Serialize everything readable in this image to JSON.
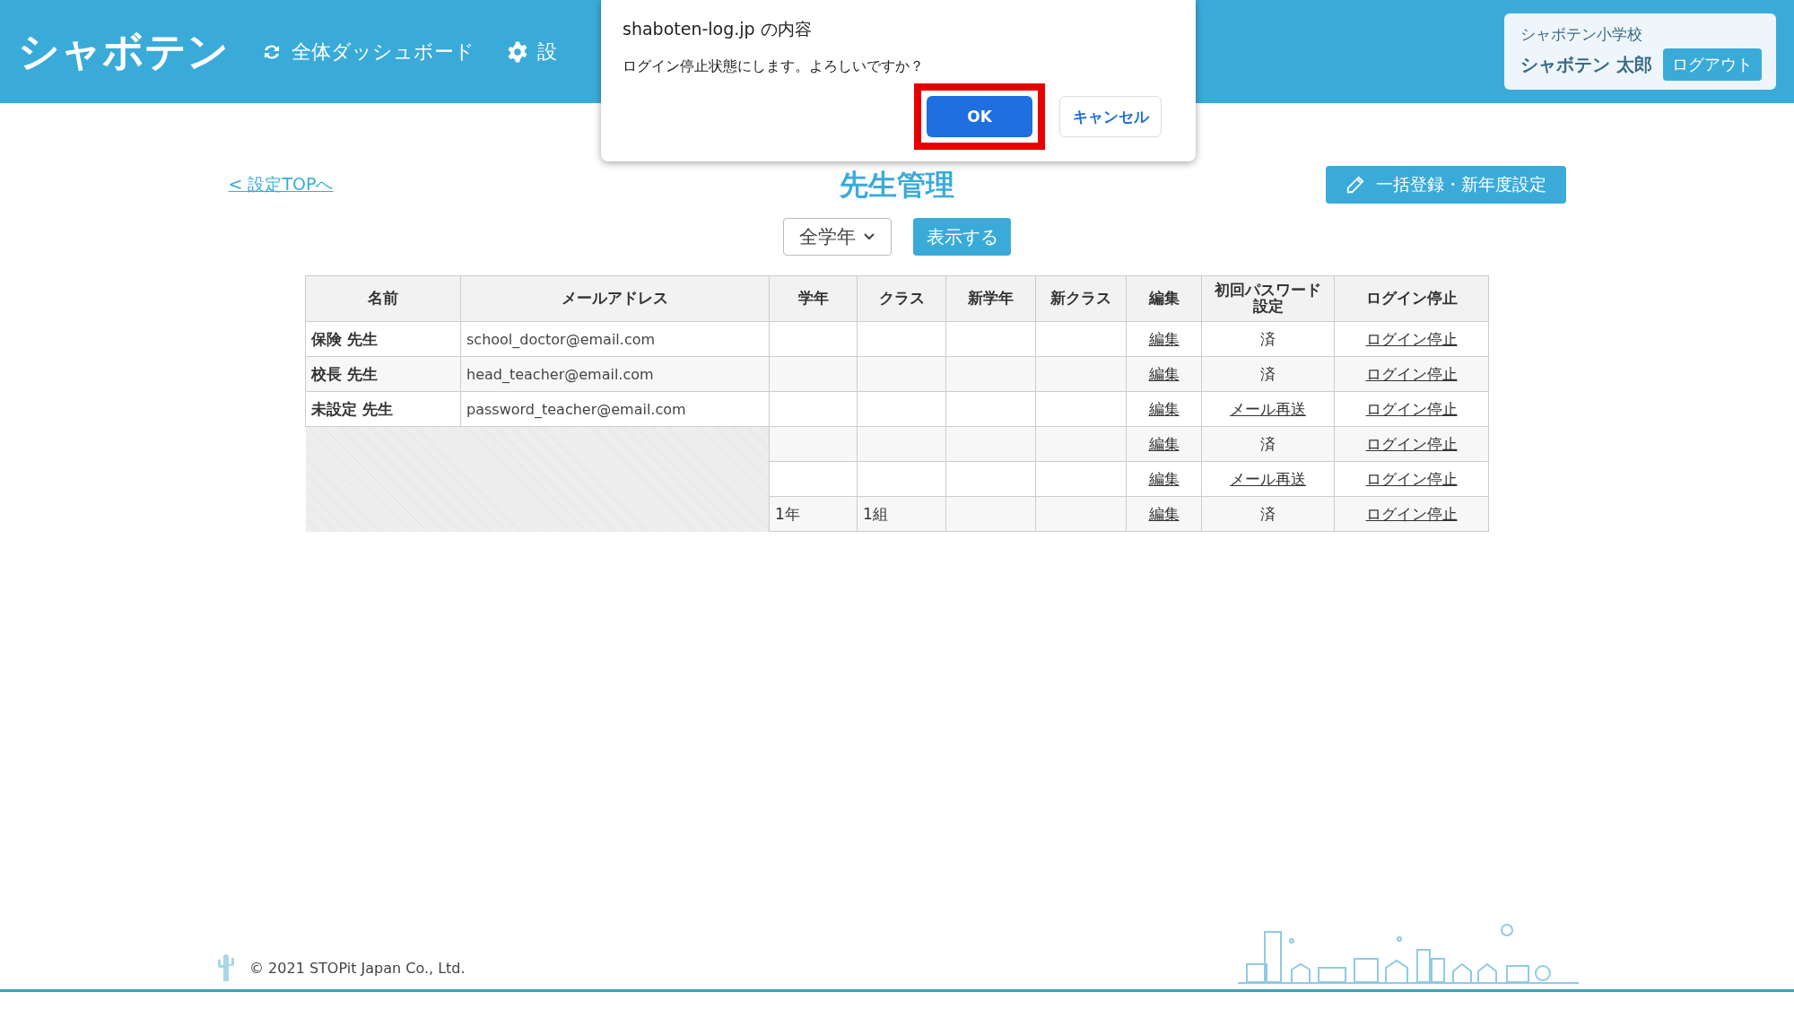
{
  "header": {
    "logo": "シャボテン",
    "nav": [
      {
        "kind": "sync",
        "label": "全体ダッシュボード"
      },
      {
        "kind": "settings",
        "label": "設"
      }
    ],
    "user": {
      "school": "シャボテン小学校",
      "name": "シャボテン 太郎",
      "logout": "ログアウト"
    }
  },
  "dialog": {
    "title": "shaboten-log.jp の内容",
    "message": "ログイン停止状態にします。よろしいですか？",
    "buttons": [
      {
        "label": "OK",
        "kind": "primary",
        "highlighted": true
      },
      {
        "label": "キャンセル",
        "kind": "secondary",
        "highlighted": false
      }
    ]
  },
  "page": {
    "back_link": "< 設定TOPへ",
    "title": "先生管理",
    "bulk_button": "一括登録・新年度設定"
  },
  "filter": {
    "grade_select": "全学年",
    "show_button": "表示する"
  },
  "table": {
    "columns": [
      "名前",
      "メールアドレス",
      "学年",
      "クラス",
      "新学年",
      "新クラス",
      "編集",
      "初回パスワード設定",
      "ログイン停止"
    ],
    "rows": [
      {
        "redacted": false,
        "name": "保険 先生",
        "email": "school_doctor@email.com",
        "edit": "編集",
        "password": {
          "kind": "done",
          "text": "済"
        },
        "stop": "ログイン停止"
      },
      {
        "redacted": false,
        "name": "校長 先生",
        "email": "head_teacher@email.com",
        "edit": "編集",
        "password": {
          "kind": "done",
          "text": "済"
        },
        "stop": "ログイン停止"
      },
      {
        "redacted": false,
        "name": "未設定 先生",
        "email": "password_teacher@email.com",
        "edit": "編集",
        "password": {
          "kind": "link",
          "text": "メール再送"
        },
        "stop": "ログイン停止"
      },
      {
        "redacted": true,
        "edit": "編集",
        "password": {
          "kind": "done",
          "text": "済"
        },
        "stop": "ログイン停止"
      },
      {
        "redacted": true,
        "edit": "編集",
        "password": {
          "kind": "link",
          "text": "メール再送"
        },
        "stop": "ログイン停止"
      },
      {
        "redacted": true,
        "grade": "1年",
        "class": "1組",
        "edit": "編集",
        "password": {
          "kind": "done",
          "text": "済"
        },
        "stop": "ログイン停止"
      }
    ]
  },
  "footer": {
    "copyright": "© 2021 STOPit Japan Co., Ltd."
  }
}
